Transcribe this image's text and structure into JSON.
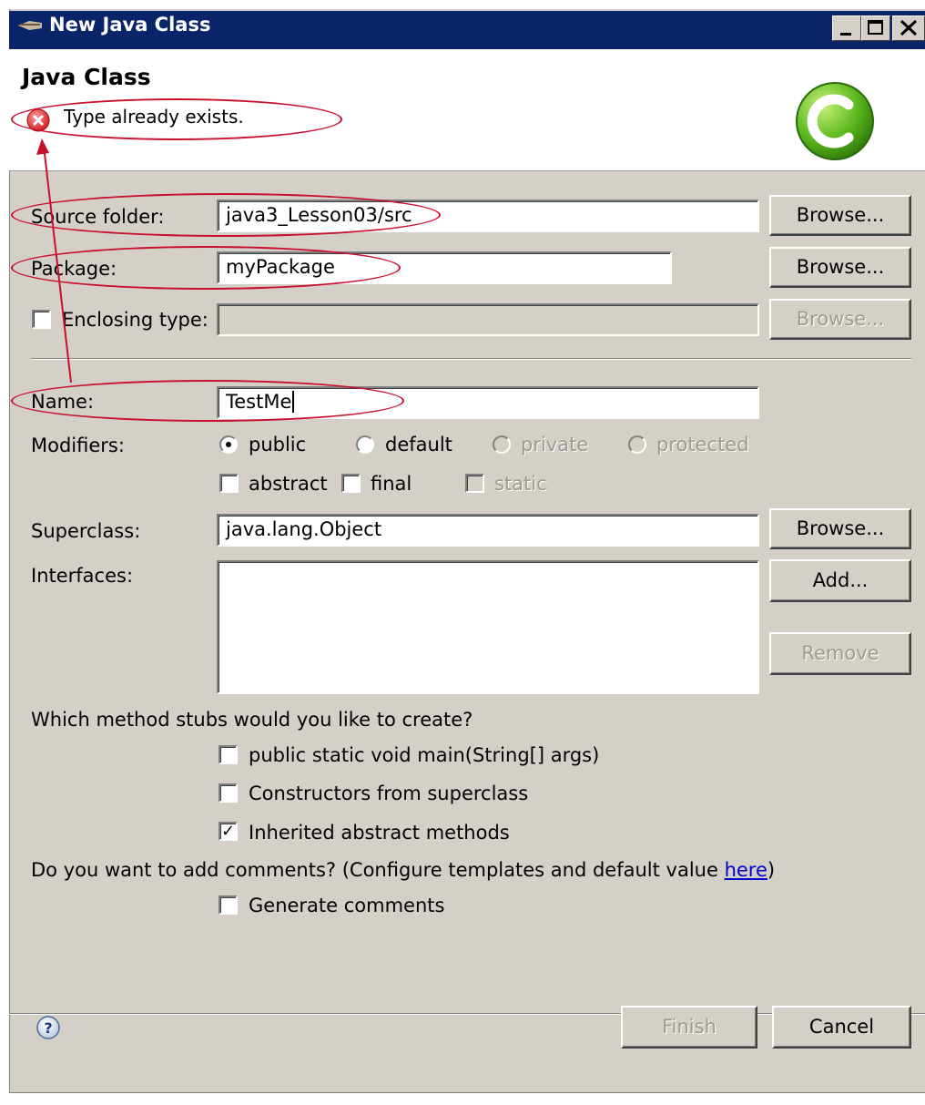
{
  "window": {
    "title": "New Java Class"
  },
  "header": {
    "title": "Java Class",
    "error_message": "Type already exists."
  },
  "form": {
    "source_folder": {
      "label": "Source folder:",
      "value": "java3_Lesson03/src",
      "browse": "Browse..."
    },
    "package": {
      "label": "Package:",
      "value": "myPackage",
      "browse": "Browse..."
    },
    "enclosing_type": {
      "label": "Enclosing type:",
      "value": "",
      "checked": false,
      "browse": "Browse..."
    },
    "name": {
      "label": "Name:",
      "value": "TestMe"
    },
    "modifiers": {
      "label": "Modifiers:",
      "options": [
        "public",
        "default",
        "private",
        "protected"
      ],
      "selected": "public",
      "checks": [
        "abstract",
        "final",
        "static"
      ]
    },
    "superclass": {
      "label": "Superclass:",
      "value": "java.lang.Object",
      "browse": "Browse..."
    },
    "interfaces": {
      "label": "Interfaces:",
      "add": "Add...",
      "remove": "Remove"
    },
    "stubs": {
      "question": "Which method stubs would you like to create?",
      "items": [
        {
          "label": "public static void main(String[] args)",
          "checked": false
        },
        {
          "label": "Constructors from superclass",
          "checked": false
        },
        {
          "label": "Inherited abstract methods",
          "checked": true
        }
      ]
    },
    "comments": {
      "question_pre": "Do you want to add comments? (Configure templates and default value ",
      "link": "here",
      "question_post": ")",
      "generate_label": "Generate comments",
      "checked": false
    }
  },
  "footer": {
    "finish": "Finish",
    "cancel": "Cancel",
    "help_glyph": "?"
  },
  "colors": {
    "annotation": "#c8102e",
    "titlebar": "#0a246a",
    "dialog_bg": "#d4d0c8"
  },
  "icons": [
    "eclipse-window-icon",
    "error-icon",
    "java-class-c-icon",
    "help-icon"
  ]
}
